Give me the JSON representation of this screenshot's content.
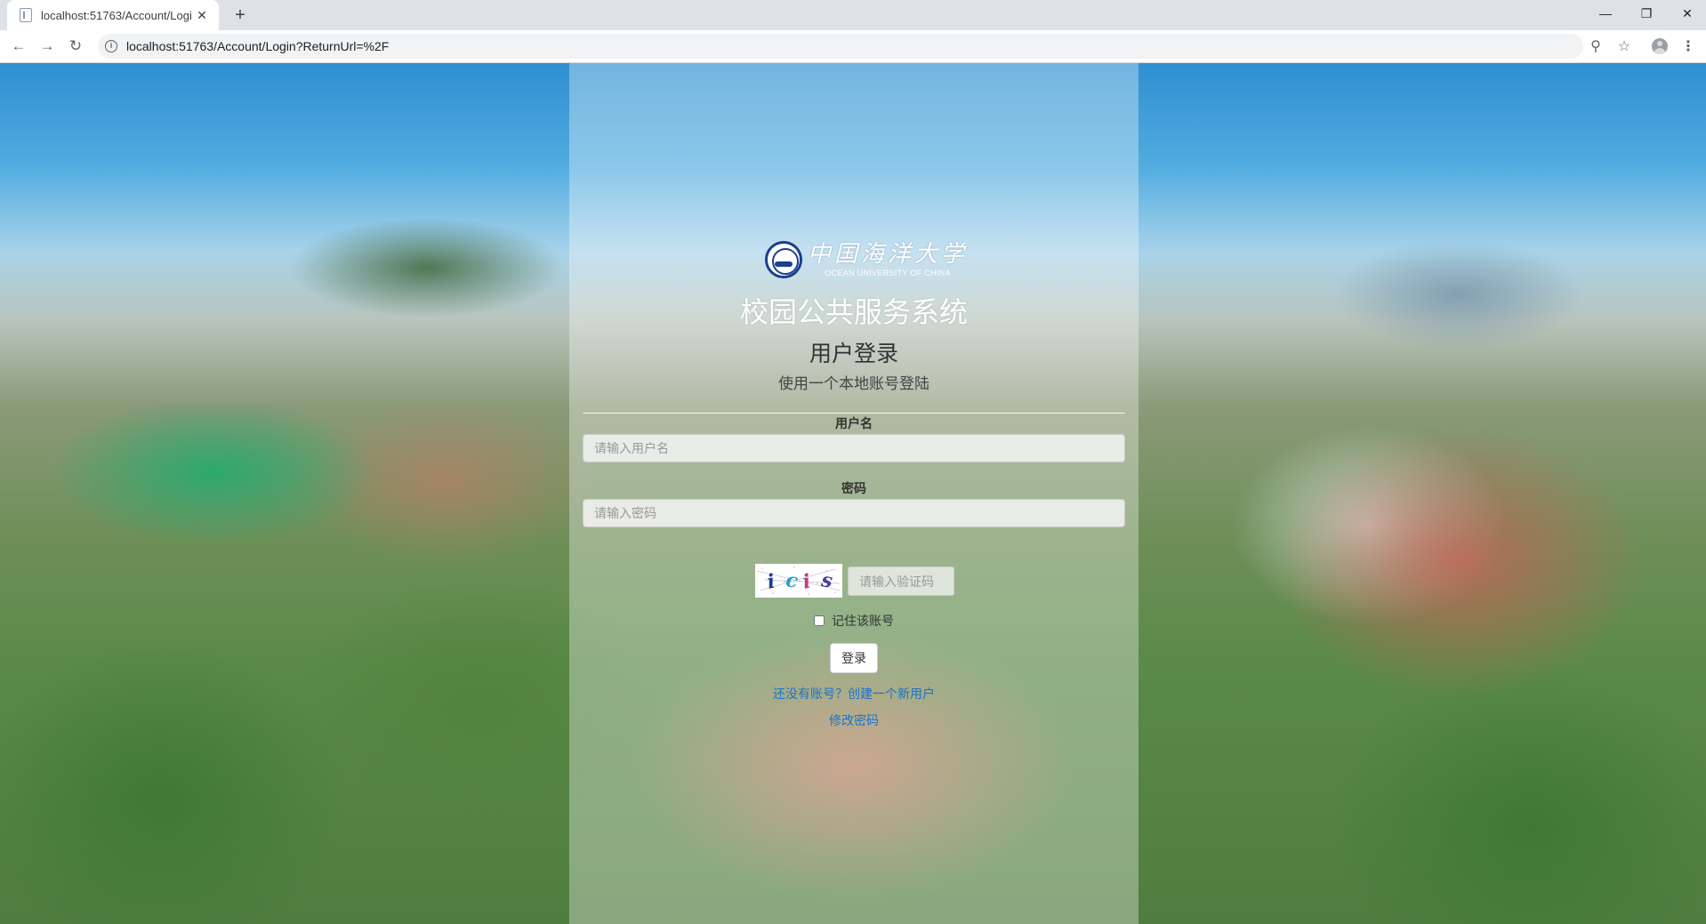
{
  "browser": {
    "tab_title": "localhost:51763/Account/Logi",
    "url": "localhost:51763/Account/Login?ReturnUrl=%2F"
  },
  "page": {
    "logo": {
      "cn": "中国海洋大学",
      "en": "OCEAN UNIVERSITY OF CHINA"
    },
    "system_title": "校园公共服务系统",
    "heading": "用户登录",
    "subheading": "使用一个本地账号登陆",
    "username": {
      "label": "用户名",
      "placeholder": "请输入用户名",
      "value": ""
    },
    "password": {
      "label": "密码",
      "placeholder": "请输入密码",
      "value": ""
    },
    "captcha": {
      "image_text": "icis",
      "placeholder": "请输入验证码"
    },
    "remember_label": "记住该账号",
    "remember_checked": false,
    "login_button": "登录",
    "register_link": "还没有账号？创建一个新用户",
    "change_password_link": "修改密码"
  },
  "colors": {
    "link": "#1a73c8",
    "seal_blue": "#1b3e8f"
  }
}
